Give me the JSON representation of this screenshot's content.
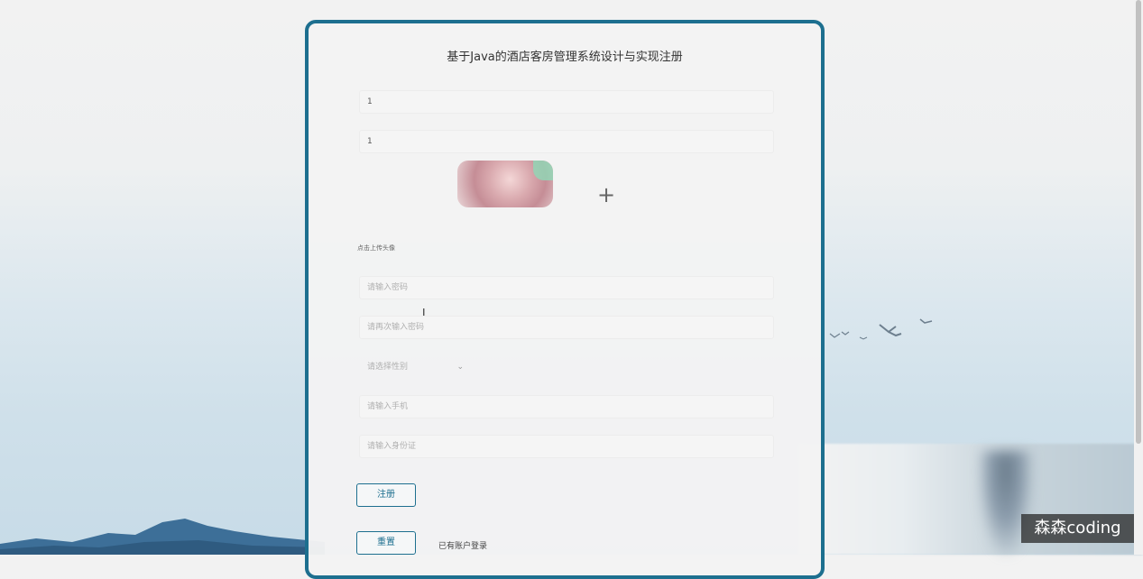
{
  "page": {
    "title": "基于Java的酒店客房管理系统设计与实现注册"
  },
  "form": {
    "account_value": "1",
    "name_value": "1",
    "upload_hint": "点击上传头像",
    "password_placeholder": "请输入密码",
    "confirm_password_placeholder": "请再次输入密码",
    "gender_placeholder": "请选择性别",
    "phone_placeholder": "请输入手机",
    "idcard_placeholder": "请输入身份证"
  },
  "actions": {
    "register_label": "注册",
    "reset_label": "重置",
    "login_link": "已有账户登录"
  },
  "icons": {
    "upload": "plus-icon",
    "dropdown": "chevron-down-icon"
  },
  "watermark": "森森coding",
  "colors": {
    "accent": "#1d6f8f",
    "card_bg": "#f3f3f3"
  }
}
